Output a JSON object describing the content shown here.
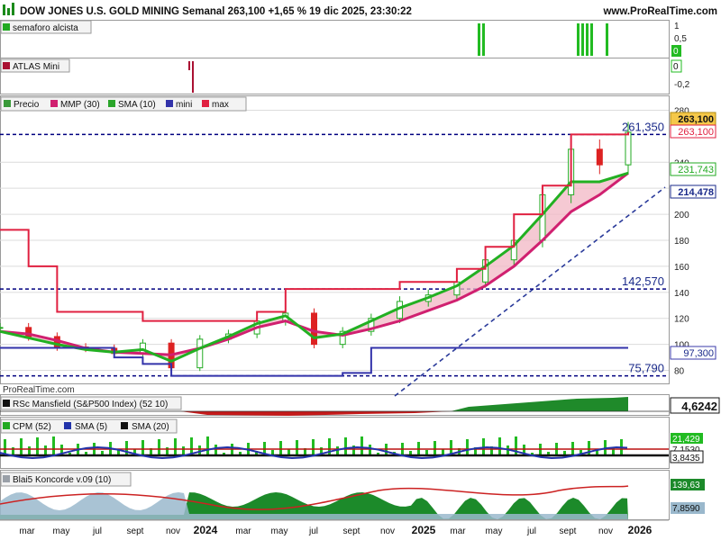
{
  "header": {
    "title": "DOW JONES U.S. GOLD MINING Semanal 263,100 +1,65 % 19 dic 2025, 23:30:22",
    "brand": "www.ProRealTime.com"
  },
  "watermark": "ProRealTime.com",
  "panels": {
    "semaforo": {
      "label": "semaforo alcista",
      "ticks": [
        "1",
        "0,5",
        "0"
      ],
      "value_box": "0"
    },
    "atlas": {
      "label": "ATLAS Mini",
      "ticks": [
        "0",
        "-0,2"
      ]
    },
    "price": {
      "legend": [
        {
          "label": "Precio",
          "color": "#3a9a3a"
        },
        {
          "label": "MMP (30)",
          "color": "#d02070"
        },
        {
          "label": "SMA (10)",
          "color": "#2aa52a"
        },
        {
          "label": "mini",
          "color": "#3333aa"
        },
        {
          "label": "max",
          "color": "#e02040"
        }
      ],
      "y_ticks": [
        "280",
        "240",
        "220",
        "200",
        "180",
        "160",
        "140",
        "120",
        "100",
        "80"
      ],
      "level_labels": [
        "261,350",
        "142,570",
        "75,790"
      ],
      "value_boxes": [
        "263,100",
        "263,100",
        "231,743",
        "214,478",
        "97,300"
      ]
    },
    "rsc": {
      "label": "RSc Mansfield (S&P500 Index) (52 10)",
      "value_box": "4,6242"
    },
    "cpm": {
      "legend": [
        "CPM (52)",
        "SMA (5)",
        "SMA (20)"
      ],
      "value_boxes": [
        "21,429",
        "7,1530",
        "3,8435"
      ]
    },
    "koncorde": {
      "label": "Blai5 Koncorde v.09 (10)",
      "value_boxes": [
        "139,63",
        "7,8590"
      ]
    }
  },
  "x_axis": [
    "mar",
    "may",
    "jul",
    "sept",
    "nov",
    "2024",
    "mar",
    "may",
    "jul",
    "sept",
    "nov",
    "2025",
    "mar",
    "may",
    "jul",
    "sept",
    "nov",
    "2026"
  ],
  "colors": {
    "price_up": "#22aa22",
    "price_down": "#dd2222",
    "mmp": "#d02070",
    "sma10": "#22b022",
    "mini": "#3333aa",
    "max": "#e02040",
    "level": "#000080"
  },
  "chart_data": {
    "type": "line",
    "title": "DOW JONES U.S. GOLD MINING Semanal 263,100 +1,65 % 19 dic 2025, 23:30:22",
    "x": [
      "2023-02",
      "2023-04",
      "2023-06",
      "2023-08",
      "2023-10",
      "2023-12",
      "2024-02",
      "2024-04",
      "2024-06",
      "2024-08",
      "2024-10",
      "2024-12",
      "2025-02",
      "2025-03",
      "2025-04",
      "2025-05",
      "2025-06",
      "2025-07",
      "2025-08",
      "2025-09",
      "2025-10",
      "2025-11",
      "2025-12"
    ],
    "ylim": [
      70,
      290
    ],
    "series": [
      {
        "name": "Precio",
        "values": [
          113,
          106,
          98,
          97,
          93,
          101,
          82,
          104,
          108,
          118,
          124,
          100,
          110,
          120,
          133,
          138,
          148,
          165,
          180,
          215,
          250,
          238,
          263.1
        ]
      },
      {
        "name": "MMP (30)",
        "values": [
          110,
          108,
          103,
          97,
          94,
          93,
          92,
          97,
          104,
          113,
          118,
          110,
          107,
          112,
          118,
          126,
          134,
          145,
          160,
          180,
          202,
          215,
          231.7
        ]
      },
      {
        "name": "SMA (10)",
        "values": [
          110,
          105,
          100,
          96,
          94,
          96,
          87,
          97,
          106,
          116,
          122,
          105,
          108,
          118,
          128,
          136,
          145,
          160,
          176,
          200,
          225,
          225,
          231.7
        ]
      },
      {
        "name": "mini",
        "values": [
          97.3,
          97.3,
          97.3,
          97.3,
          90,
          85,
          75.8,
          75.8,
          75.8,
          75.8,
          75.8,
          75.8,
          78,
          97.3,
          97.3,
          97.3,
          97.3,
          97.3,
          97.3,
          97.3,
          97.3,
          97.3,
          97.3
        ]
      },
      {
        "name": "max",
        "values": [
          188,
          160,
          125,
          125,
          125,
          118,
          118,
          118,
          118,
          125,
          142.57,
          142.57,
          142.57,
          142.57,
          148,
          148,
          158,
          175,
          200,
          222,
          261.35,
          261.35,
          263.1
        ]
      }
    ],
    "levels": [
      261.35,
      142.57,
      75.79
    ]
  }
}
